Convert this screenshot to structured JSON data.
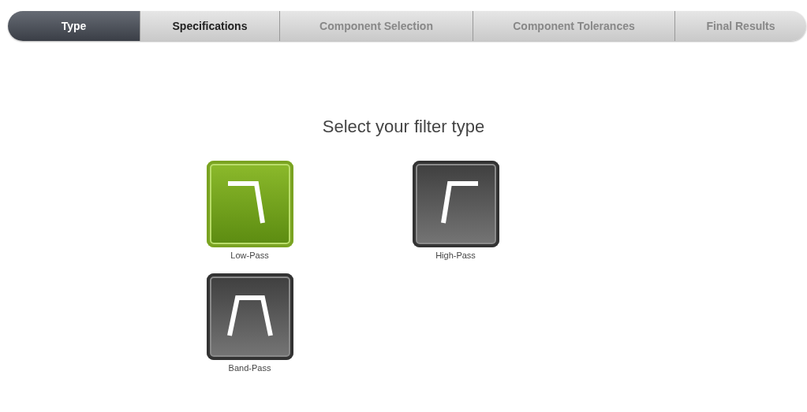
{
  "steps": [
    {
      "label": "Type",
      "selected": true,
      "disabled": false
    },
    {
      "label": "Specifications",
      "selected": false,
      "disabled": false
    },
    {
      "label": "Component Selection",
      "selected": false,
      "disabled": true
    },
    {
      "label": "Component Tolerances",
      "selected": false,
      "disabled": true
    },
    {
      "label": "Final Results",
      "selected": false,
      "disabled": true
    }
  ],
  "heading": "Select your filter type",
  "filters": [
    {
      "kind": "low-pass",
      "label": "Low-Pass",
      "selected": true
    },
    {
      "kind": "high-pass",
      "label": "High-Pass",
      "selected": false
    },
    {
      "kind": "band-pass",
      "label": "Band-Pass",
      "selected": false
    }
  ]
}
